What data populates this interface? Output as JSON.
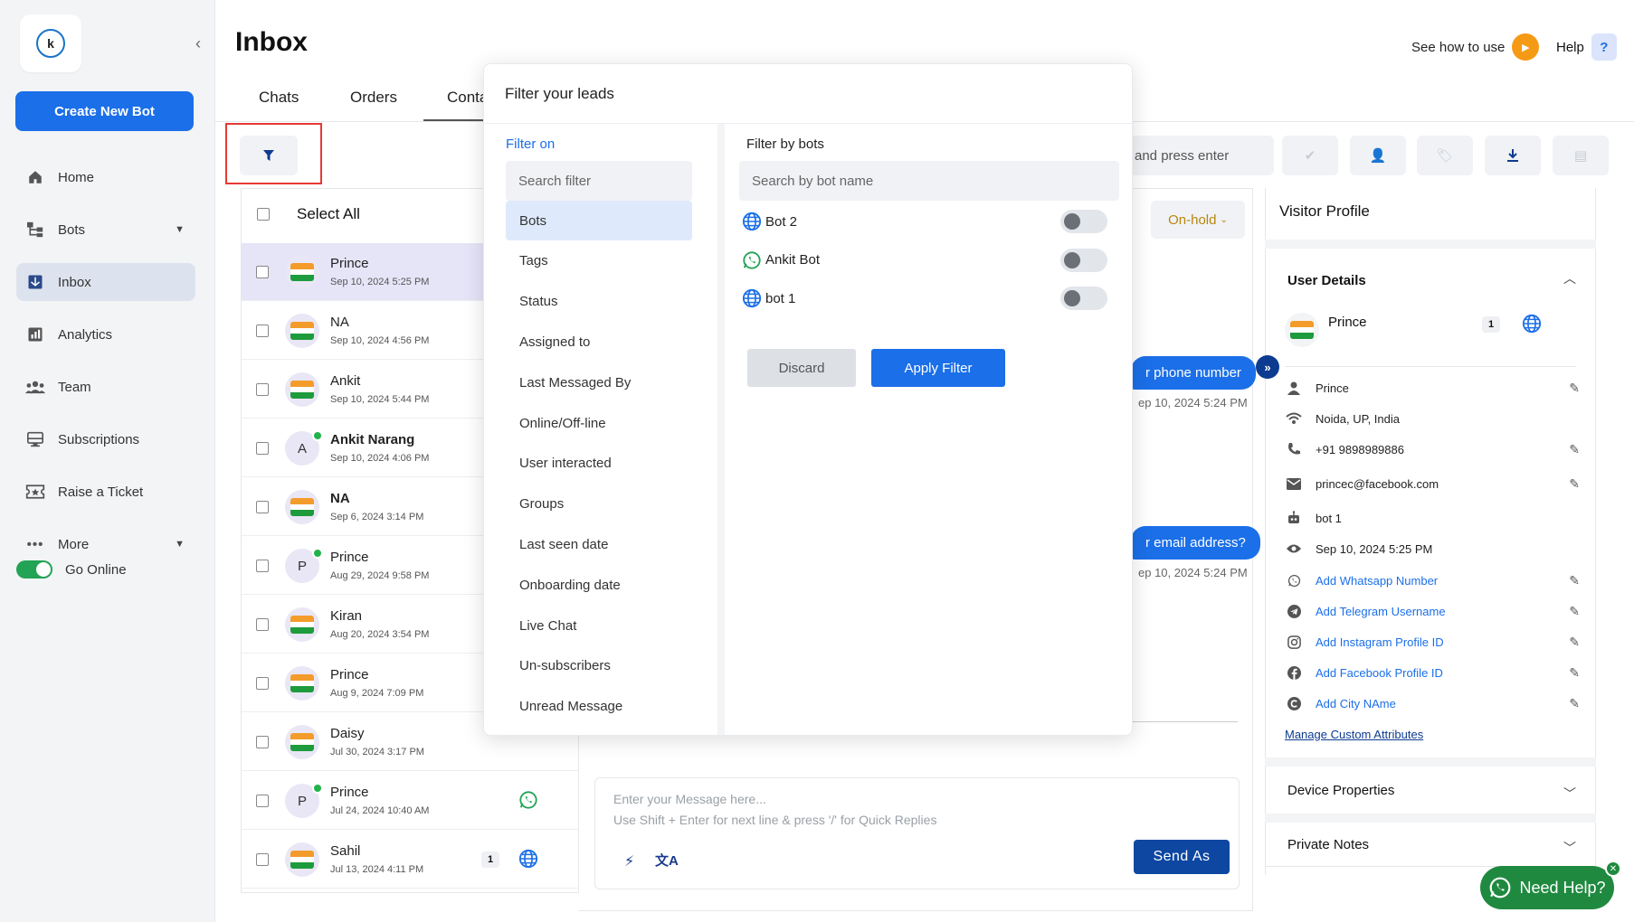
{
  "colors": {
    "primary": "#1b6fe8",
    "dark_blue": "#0d47a1",
    "online_green": "#22b24c",
    "highlight_red": "#e53935",
    "onhold_gold": "#b8860b",
    "help_orange": "#f59a14"
  },
  "sidebar": {
    "create_bot": "Create New Bot",
    "items": [
      {
        "label": "Home",
        "icon": "home-icon"
      },
      {
        "label": "Bots",
        "icon": "bots-icon"
      },
      {
        "label": "Inbox",
        "icon": "inbox-icon"
      },
      {
        "label": "Analytics",
        "icon": "analytics-icon"
      },
      {
        "label": "Team",
        "icon": "team-icon"
      },
      {
        "label": "Subscriptions",
        "icon": "subscriptions-icon"
      },
      {
        "label": "Raise a Ticket",
        "icon": "ticket-icon"
      },
      {
        "label": "More",
        "icon": "more-icon"
      }
    ],
    "go_online": "Go Online"
  },
  "header": {
    "title": "Inbox",
    "see_how": "See how to use",
    "help": "Help",
    "help_icon": "?"
  },
  "tabs": [
    {
      "label": "Chats"
    },
    {
      "label": "Orders"
    },
    {
      "label": "Conta"
    }
  ],
  "list": {
    "select_all": "Select All",
    "rows": [
      {
        "name": "Prince",
        "date": "Sep 10, 2024 5:25 PM",
        "avatar": "flag",
        "selected": true
      },
      {
        "name": "NA",
        "date": "Sep 10, 2024 4:56 PM",
        "avatar": "flag"
      },
      {
        "name": "Ankit",
        "date": "Sep 10, 2024 5:44 PM",
        "avatar": "flag"
      },
      {
        "name": "Ankit Narang",
        "date": "Sep 10, 2024 4:06 PM",
        "avatar": "letter",
        "initial": "A",
        "online": true,
        "bold": true
      },
      {
        "name": "NA",
        "date": "Sep 6, 2024 3:14 PM",
        "avatar": "flag",
        "bold": true
      },
      {
        "name": "Prince",
        "date": "Aug 29, 2024 9:58 PM",
        "avatar": "letter",
        "initial": "P",
        "online": true
      },
      {
        "name": "Kiran",
        "date": "Aug 20, 2024 3:54 PM",
        "avatar": "flag"
      },
      {
        "name": "Prince",
        "date": "Aug 9, 2024 7:09 PM",
        "avatar": "flag"
      },
      {
        "name": "Daisy",
        "date": "Jul 30, 2024 3:17 PM",
        "avatar": "flag"
      },
      {
        "name": "Prince",
        "date": "Jul 24, 2024 10:40 AM",
        "avatar": "letter",
        "initial": "P",
        "online": true,
        "channel": "whatsapp"
      },
      {
        "name": "Sahil",
        "date": "Jul 13, 2024 4:11 PM",
        "avatar": "flag",
        "badge": "1",
        "channel": "web"
      }
    ]
  },
  "chat": {
    "search_hint": "and press enter",
    "status": "On-hold",
    "bubble1": "r phone number",
    "time1": "ep 10, 2024 5:24 PM",
    "bubble2": "r email address?",
    "time2": "ep 10, 2024 5:24 PM",
    "composer_placeholder_1": "Enter your Message here...",
    "composer_placeholder_2": "Use Shift + Enter for next line & press '/' for Quick Replies",
    "send_as": "Send As"
  },
  "profile": {
    "title": "Visitor Profile",
    "user_details": "User Details",
    "name": "Prince",
    "badge": "1",
    "attributes": [
      {
        "icon": "person-icon",
        "text": "Prince",
        "link": false,
        "edit": true
      },
      {
        "icon": "location-icon",
        "text": "Noida, UP, India",
        "link": false,
        "edit": false
      },
      {
        "icon": "phone-icon",
        "text": "+91 9898989886",
        "link": false,
        "edit": true
      },
      {
        "icon": "email-icon",
        "text": "princec@facebook.com",
        "link": false,
        "edit": true
      },
      {
        "icon": "bot-icon",
        "text": "bot 1",
        "link": false,
        "edit": false
      },
      {
        "icon": "eye-icon",
        "text": "Sep 10, 2024 5:25 PM",
        "link": false,
        "edit": false
      },
      {
        "icon": "whatsapp-icon",
        "text": "Add Whatsapp Number",
        "link": true,
        "edit": true
      },
      {
        "icon": "telegram-icon",
        "text": "Add Telegram Username",
        "link": true,
        "edit": true
      },
      {
        "icon": "instagram-icon",
        "text": "Add Instagram Profile ID",
        "link": true,
        "edit": true
      },
      {
        "icon": "facebook-icon",
        "text": "Add Facebook Profile ID",
        "link": true,
        "edit": true
      },
      {
        "icon": "city-icon",
        "text": "Add City NAme",
        "link": true,
        "edit": true
      }
    ],
    "manage": "Manage Custom Attributes",
    "device_properties": "Device Properties",
    "private_notes": "Private Notes"
  },
  "need_help": "Need Help?",
  "filter": {
    "title": "Filter your leads",
    "filter_on": "Filter on",
    "search_placeholder": "Search filter",
    "options": [
      "Bots",
      "Tags",
      "Status",
      "Assigned to",
      "Last Messaged By",
      "Online/Off-line",
      "User interacted",
      "Groups",
      "Last seen date",
      "Onboarding date",
      "Live Chat",
      "Un-subscribers",
      "Unread Message"
    ],
    "active_option": "Bots",
    "by_bots": "Filter by bots",
    "bot_search_placeholder": "Search by bot name",
    "bots": [
      {
        "name": "Bot 2",
        "channel": "web",
        "enabled": false
      },
      {
        "name": "Ankit Bot",
        "channel": "whatsapp",
        "enabled": false
      },
      {
        "name": "bot 1",
        "channel": "web",
        "enabled": false
      }
    ],
    "discard": "Discard",
    "apply": "Apply Filter"
  }
}
